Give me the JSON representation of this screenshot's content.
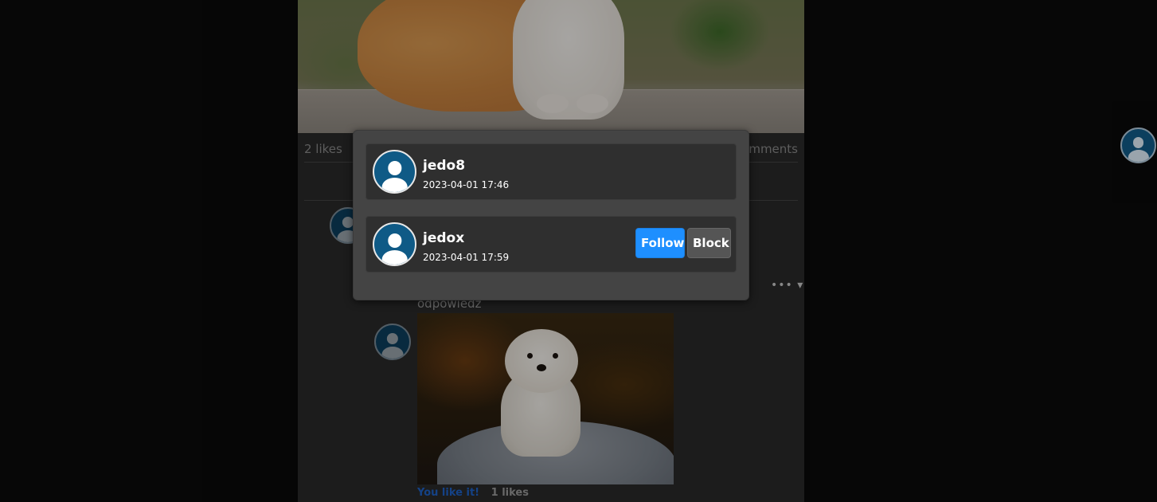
{
  "post": {
    "likes": "2 likes",
    "comments": "omments"
  },
  "reply": {
    "text": "odpowiedz",
    "you_like": "You like it!",
    "likes": "1 likes",
    "more_icon": "ellipsis-dropdown-icon"
  },
  "modal": {
    "users": [
      {
        "name": "jedo8",
        "date": "2023-04-01 17:46"
      },
      {
        "name": "jedox",
        "date": "2023-04-01 17:59",
        "follow_label": "Follow",
        "block_label": "Block"
      }
    ]
  },
  "colors": {
    "accent": "#1e8fff",
    "avatar_bg": "#0f5a86",
    "modal_bg": "#444444",
    "card_bg": "#2f2f2f"
  }
}
